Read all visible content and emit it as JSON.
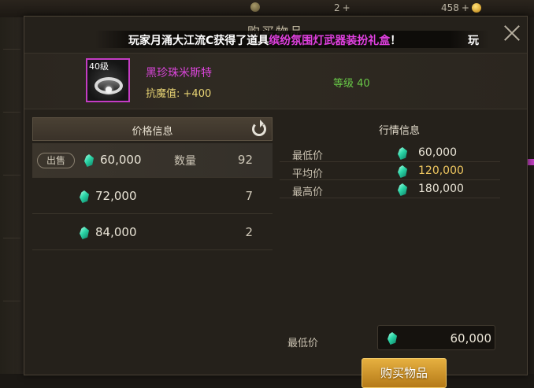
{
  "background": {
    "stat_1": "2",
    "stat_2": "458"
  },
  "dialog": {
    "title": "购买物品",
    "broadcast": {
      "prefix": "玩家月涌大江流C获得了道具",
      "highlight": "缤纷氛围灯武器装扮礼盒",
      "suffix": "！",
      "tail": "玩"
    }
  },
  "item": {
    "level_badge": "40级",
    "name": "黑珍珠米斯特",
    "stat_label": "抗魔值:",
    "stat_value": "+400",
    "requirement": "等级 40"
  },
  "price_panel": {
    "header": "价格信息",
    "sell_tag": "出售",
    "qty_label": "数量",
    "rows": [
      {
        "price": "60,000",
        "qty": "92"
      },
      {
        "price": "72,000",
        "qty": "7"
      },
      {
        "price": "84,000",
        "qty": "2"
      }
    ]
  },
  "market_panel": {
    "header": "行情信息",
    "rows": [
      {
        "label": "最低价",
        "value": "60,000"
      },
      {
        "label": "平均价",
        "value": "120,000"
      },
      {
        "label": "最高价",
        "value": "180,000"
      }
    ],
    "min_label": "最低价",
    "input_value": "60,000",
    "buy_label": "购买物品"
  },
  "colors": {
    "rarity_purple": "#d845d8",
    "level_green": "#69c948",
    "average_gold": "#f0c860",
    "buy_button": "#d9a032"
  },
  "icons": [
    "close-icon",
    "refresh-icon",
    "gem-icon",
    "coin-icon",
    "ring-item-icon"
  ]
}
